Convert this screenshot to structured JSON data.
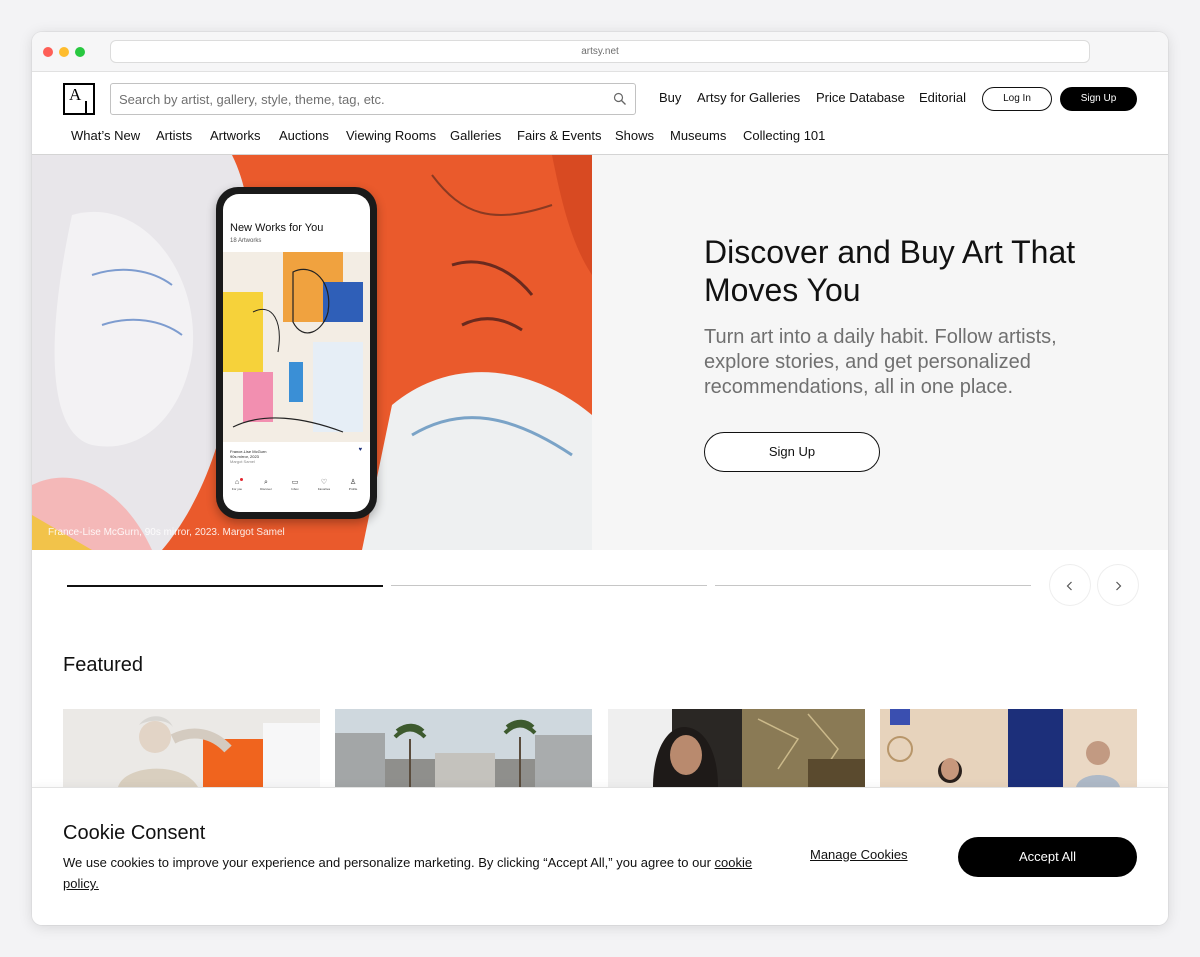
{
  "browser": {
    "url": "artsy.net"
  },
  "header": {
    "search_placeholder": "Search by artist, gallery, style, theme, tag, etc.",
    "links": [
      "Buy",
      "Artsy for Galleries",
      "Price Database",
      "Editorial"
    ],
    "login_label": "Log In",
    "signup_label": "Sign Up"
  },
  "nav": {
    "items": [
      "What’s New",
      "Artists",
      "Artworks",
      "Auctions",
      "Viewing Rooms",
      "Galleries",
      "Fairs & Events",
      "Shows",
      "Museums",
      "Collecting 101"
    ]
  },
  "hero": {
    "caption": "France-Lise McGurn, 90s mirror, 2023. Margot Samel",
    "phone": {
      "title": "New Works for You",
      "subtitle": "18 Artworks",
      "artwork_artist": "France-Lise McGurn",
      "artwork_title": "90s mirror, 2023",
      "artwork_gallery": "Margot Samel",
      "tabs": [
        "For you",
        "Discover",
        "Inbox",
        "Favorites",
        "Profile"
      ]
    },
    "title": "Discover and Buy Art That Moves You",
    "subtitle": "Turn art into a daily habit. Follow artists, explore stories, and get personalized recommendations, all in one place.",
    "cta_label": "Sign Up"
  },
  "carousel": {
    "slide_count": 3,
    "active_index": 0,
    "active_progress": 1.0,
    "prev_icon": "chevron-left-icon",
    "next_icon": "chevron-right-icon"
  },
  "featured": {
    "heading": "Featured"
  },
  "cookie": {
    "title": "Cookie Consent",
    "body": "We use cookies to improve your experience and personalize marketing. By clicking “Accept All,” you agree to our",
    "link_text": "cookie policy.",
    "manage_label": "Manage Cookies",
    "accept_label": "Accept All"
  },
  "colors": {
    "brand_black": "#000000",
    "hero_orange": "#ea5a2c",
    "muted_text": "#707070"
  }
}
